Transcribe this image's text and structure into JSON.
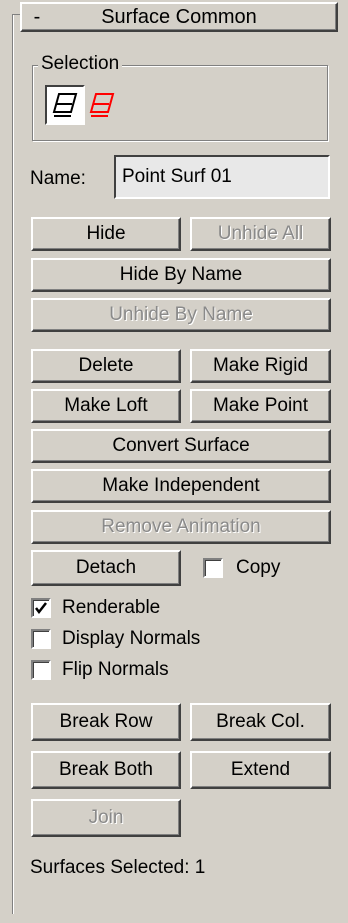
{
  "rollout": {
    "collapse_glyph": "-",
    "title": "Surface Common"
  },
  "selection": {
    "group_label": "Selection",
    "buttons": [
      {
        "icon": "surface-level-icon",
        "active": true,
        "color": "#000000"
      },
      {
        "icon": "surface-cv-icon",
        "active": false,
        "color": "#ff0000"
      }
    ]
  },
  "name": {
    "label": "Name:",
    "value": "Point Surf 01"
  },
  "buttons": {
    "hide": "Hide",
    "unhide_all": "Unhide All",
    "hide_by_name": "Hide By Name",
    "unhide_by_name": "Unhide By Name",
    "delete": "Delete",
    "make_rigid": "Make Rigid",
    "make_loft": "Make Loft",
    "make_point": "Make Point",
    "convert_surface": "Convert Surface",
    "make_independent": "Make Independent",
    "remove_animation": "Remove Animation",
    "detach": "Detach",
    "break_row": "Break Row",
    "break_col": "Break Col.",
    "break_both": "Break Both",
    "extend": "Extend",
    "join": "Join"
  },
  "checkboxes": {
    "copy": {
      "label": "Copy",
      "checked": false
    },
    "renderable": {
      "label": "Renderable",
      "checked": true
    },
    "display_normals": {
      "label": "Display Normals",
      "checked": false
    },
    "flip_normals": {
      "label": "Flip Normals",
      "checked": false
    }
  },
  "status": {
    "text": "Surfaces Selected: 1"
  }
}
